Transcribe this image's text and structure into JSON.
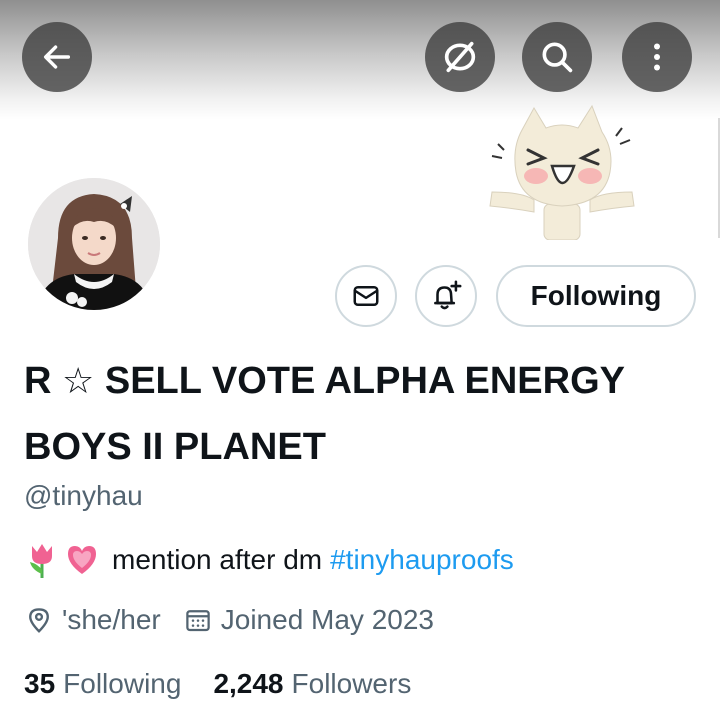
{
  "header": {
    "icons": [
      "back-arrow-icon",
      "hide-media-icon",
      "search-icon",
      "more-vertical-icon"
    ]
  },
  "actions": {
    "message_icon": "envelope-icon",
    "notify_icon": "bell-plus-icon",
    "follow_label": "Following"
  },
  "profile": {
    "name_prefix": "R",
    "name_star": "☆",
    "name_rest": "SELL VOTE ALPHA ENERGY BOYS II PLANET",
    "handle": "@tinyhau",
    "bio_emojis": [
      "tulip-emoji",
      "growing-heart-emoji"
    ],
    "bio_text": "mention after dm",
    "bio_hashtag": "#tinyhauproofs",
    "location": "'she/her",
    "joined": "Joined May 2023",
    "following_count": "35",
    "following_label": "Following",
    "followers_count": "2,248",
    "followers_label": "Followers"
  },
  "colors": {
    "link": "#1d9bf0",
    "secondary_text": "#536471",
    "primary_text": "#0f1419",
    "button_border": "#cfd9de"
  }
}
